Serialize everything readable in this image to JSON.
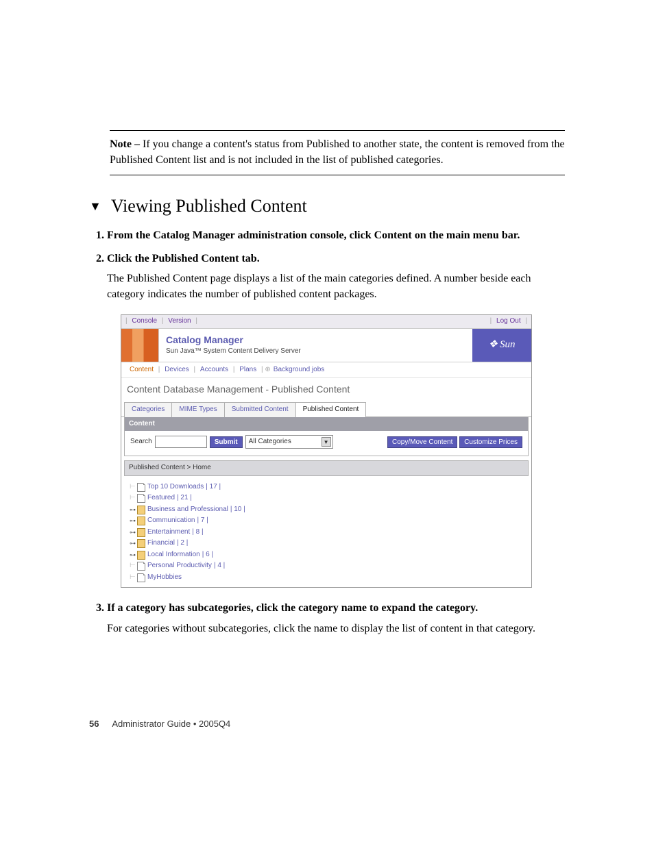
{
  "note": {
    "label": "Note –",
    "text": "If you change a content's status from Published to another state, the content is removed from the Published Content list and is not included in the list of published categories."
  },
  "section_heading": "Viewing Published Content",
  "triangle": "▼",
  "steps": {
    "s1": "From the Catalog Manager administration console, click Content on the main menu bar.",
    "s2_head": "Click the Published Content tab.",
    "s2_body": "The Published Content page displays a list of the main categories defined. A number beside each category indicates the number of published content packages.",
    "s3_head": "If a category has subcategories, click the category name to expand the category.",
    "s3_body": "For categories without subcategories, click the name to display the list of content in that category."
  },
  "shot": {
    "top": {
      "console": "Console",
      "version": "Version",
      "logout": "Log Out"
    },
    "header": {
      "title": "Catalog Manager",
      "subtitle": "Sun Java™ System Content Delivery Server",
      "brand": "Sun"
    },
    "menubar": {
      "content": "Content",
      "devices": "Devices",
      "accounts": "Accounts",
      "plans": "Plans",
      "jobs": "Background jobs"
    },
    "h1": "Content Database Management - Published Content",
    "tabs": {
      "cat": "Categories",
      "mime": "MIME Types",
      "sub": "Submitted Content",
      "pub": "Published Content"
    },
    "panel": {
      "hdr": "Content",
      "search_label": "Search",
      "submit": "Submit",
      "select": "All Categories",
      "copy": "Copy/Move Content",
      "prices": "Customize Prices"
    },
    "breadcrumb": "Published Content  >  Home",
    "tree": [
      {
        "expandable": false,
        "folder": false,
        "label": "Top 10 Downloads",
        "count": "| 17 |"
      },
      {
        "expandable": false,
        "folder": false,
        "label": "Featured",
        "count": "| 21 |"
      },
      {
        "expandable": true,
        "folder": true,
        "label": "Business and Professional",
        "count": "| 10 |"
      },
      {
        "expandable": true,
        "folder": true,
        "label": "Communication",
        "count": "| 7 |"
      },
      {
        "expandable": true,
        "folder": true,
        "label": "Entertainment",
        "count": "| 8 |"
      },
      {
        "expandable": true,
        "folder": true,
        "label": "Financial",
        "count": "| 2 |"
      },
      {
        "expandable": true,
        "folder": true,
        "label": "Local Information",
        "count": "| 6 |"
      },
      {
        "expandable": false,
        "folder": false,
        "label": "Personal Productivity",
        "count": "| 4 |"
      },
      {
        "expandable": false,
        "folder": false,
        "label": "MyHobbies",
        "count": ""
      }
    ]
  },
  "footer": {
    "page": "56",
    "text": "Administrator Guide  •  2005Q4"
  }
}
